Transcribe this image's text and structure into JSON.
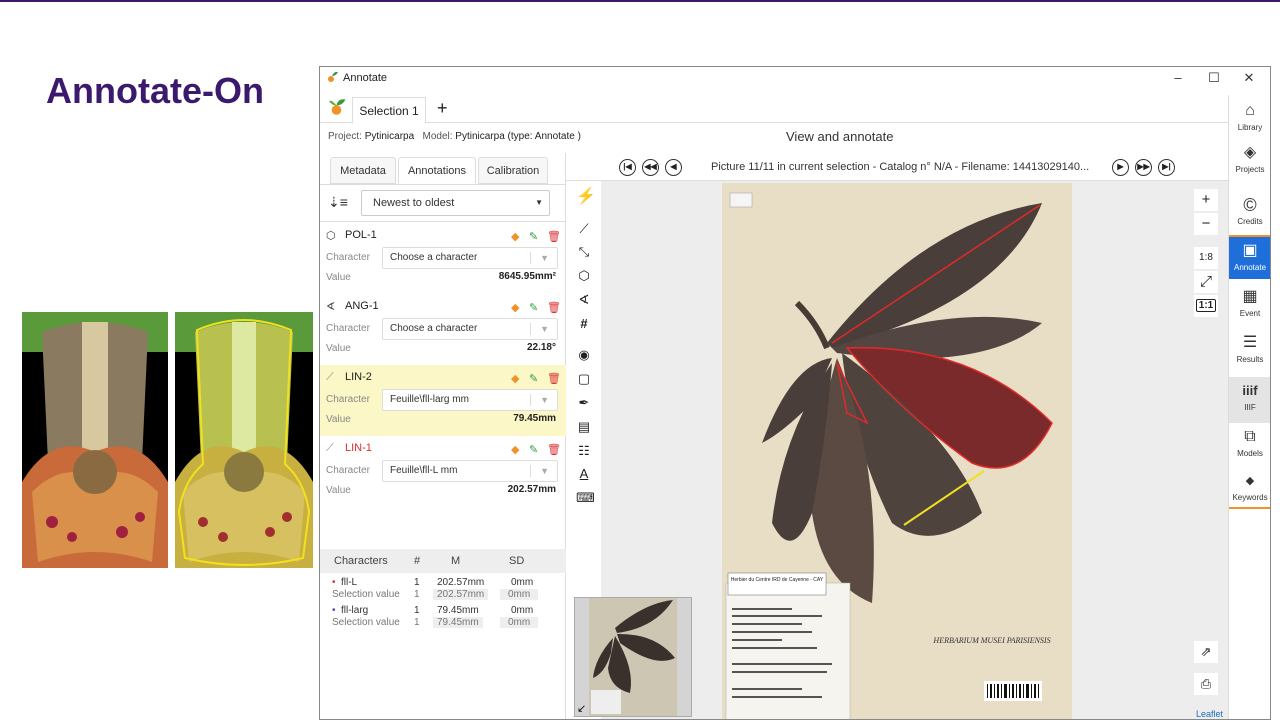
{
  "slide": {
    "title": "Annotate-On"
  },
  "window": {
    "title": "Annotate",
    "controls": {
      "minimize": "–",
      "maximize": "☐",
      "close": "✕"
    }
  },
  "tabs": {
    "selection": "Selection 1",
    "add": "+"
  },
  "project": {
    "project_label": "Project:",
    "project_name": "Pytinicarpa",
    "model_label": "Model:",
    "model_name": "Pytinicarpa (type: Annotate )",
    "view_title": "View and annotate"
  },
  "left_tabs": [
    "Metadata",
    "Annotations",
    "Calibration"
  ],
  "sort": {
    "icon": "sort-desc-icon",
    "value": "Newest to oldest"
  },
  "annotations": [
    {
      "icon": "polygon-icon",
      "glyph": "⬡",
      "name": "POL-1",
      "character_label": "Character",
      "character": "Choose a character",
      "value_label": "Value",
      "value": "8645.95mm²",
      "highlighted": false,
      "name_color": "default"
    },
    {
      "icon": "angle-icon",
      "glyph": "∢",
      "name": "ANG-1",
      "character_label": "Character",
      "character": "Choose a character",
      "value_label": "Value",
      "value": "22.18°",
      "highlighted": false,
      "name_color": "default"
    },
    {
      "icon": "line-icon",
      "glyph": "⟋",
      "name": "LIN-2",
      "character_label": "Character",
      "character": "Feuille\\fll-larg mm",
      "value_label": "Value",
      "value": "79.45mm",
      "highlighted": true,
      "name_color": "default"
    },
    {
      "icon": "line-icon",
      "glyph": "⟋",
      "name": "LIN-1",
      "character_label": "Character",
      "character": "Feuille\\fll-L mm",
      "value_label": "Value",
      "value": "202.57mm",
      "highlighted": false,
      "name_color": "#d93030"
    }
  ],
  "stats": {
    "headers": [
      "Characters",
      "#",
      "M",
      "SD"
    ],
    "rows": [
      {
        "name": "fll-L",
        "bullet_color": "#d93030",
        "count": "1",
        "mean": "202.57mm",
        "sd": "0mm",
        "sub_label": "Selection value",
        "sub_count": "1",
        "sub_mean": "202.57mm",
        "sub_sd": "0mm"
      },
      {
        "name": "fll-larg",
        "bullet_color": "#5b3fb0",
        "count": "1",
        "mean": "79.45mm",
        "sd": "0mm",
        "sub_label": "Selection value",
        "sub_count": "1",
        "sub_mean": "79.45mm",
        "sub_sd": "0mm"
      }
    ]
  },
  "viewer": {
    "nav_text": "Picture 11/11 in current selection - Catalog n° N/A - Filename: 14413029140...",
    "nav_buttons": [
      "first",
      "previous-fast",
      "previous",
      "next",
      "next-fast",
      "last"
    ],
    "zoom": {
      "in": "+",
      "out": "−",
      "ratio": "1:8",
      "fit": "⤢",
      "one_to_one": "1:1"
    },
    "leaflet": "Leaflet",
    "herbarium_stamp": "HERBARIUM MUSEI PARISIENSIS",
    "label_title": "Herbier du Centre IRD de Cayenne - CAY"
  },
  "tools": [
    "lightning-icon",
    "line-icon",
    "polyline-icon",
    "polygon-icon",
    "angle-icon",
    "grid-icon",
    "marker-icon",
    "rectangle-icon",
    "color-picker-icon",
    "transcription-icon",
    "list-icon",
    "text-icon",
    "ocr-icon"
  ],
  "sidebar": [
    {
      "label": "Library",
      "icon": "library-icon",
      "glyph": "⌂"
    },
    {
      "label": "Projects",
      "icon": "layers-icon",
      "glyph": "◈"
    },
    {
      "label": "Credits",
      "icon": "copyright-icon",
      "glyph": "©"
    },
    {
      "label": "Annotate",
      "icon": "image-icon",
      "glyph": "▣",
      "active": true
    },
    {
      "label": "Event",
      "icon": "calendar-icon",
      "glyph": "▦"
    },
    {
      "label": "Results",
      "icon": "list-icon",
      "glyph": "☰"
    },
    {
      "label": "IIIF",
      "icon": "iiif-icon",
      "glyph": "iiif"
    },
    {
      "label": "Models",
      "icon": "models-icon",
      "glyph": "⧉"
    },
    {
      "label": "Keywords",
      "icon": "tag-icon",
      "glyph": "◆"
    }
  ],
  "colors": {
    "accent": "#1e6fd9",
    "title": "#3b1a6e",
    "highlight": "#fbf7c6",
    "delete": "#d93030",
    "tag": "#f0912a",
    "edit": "#2e9d3f"
  }
}
